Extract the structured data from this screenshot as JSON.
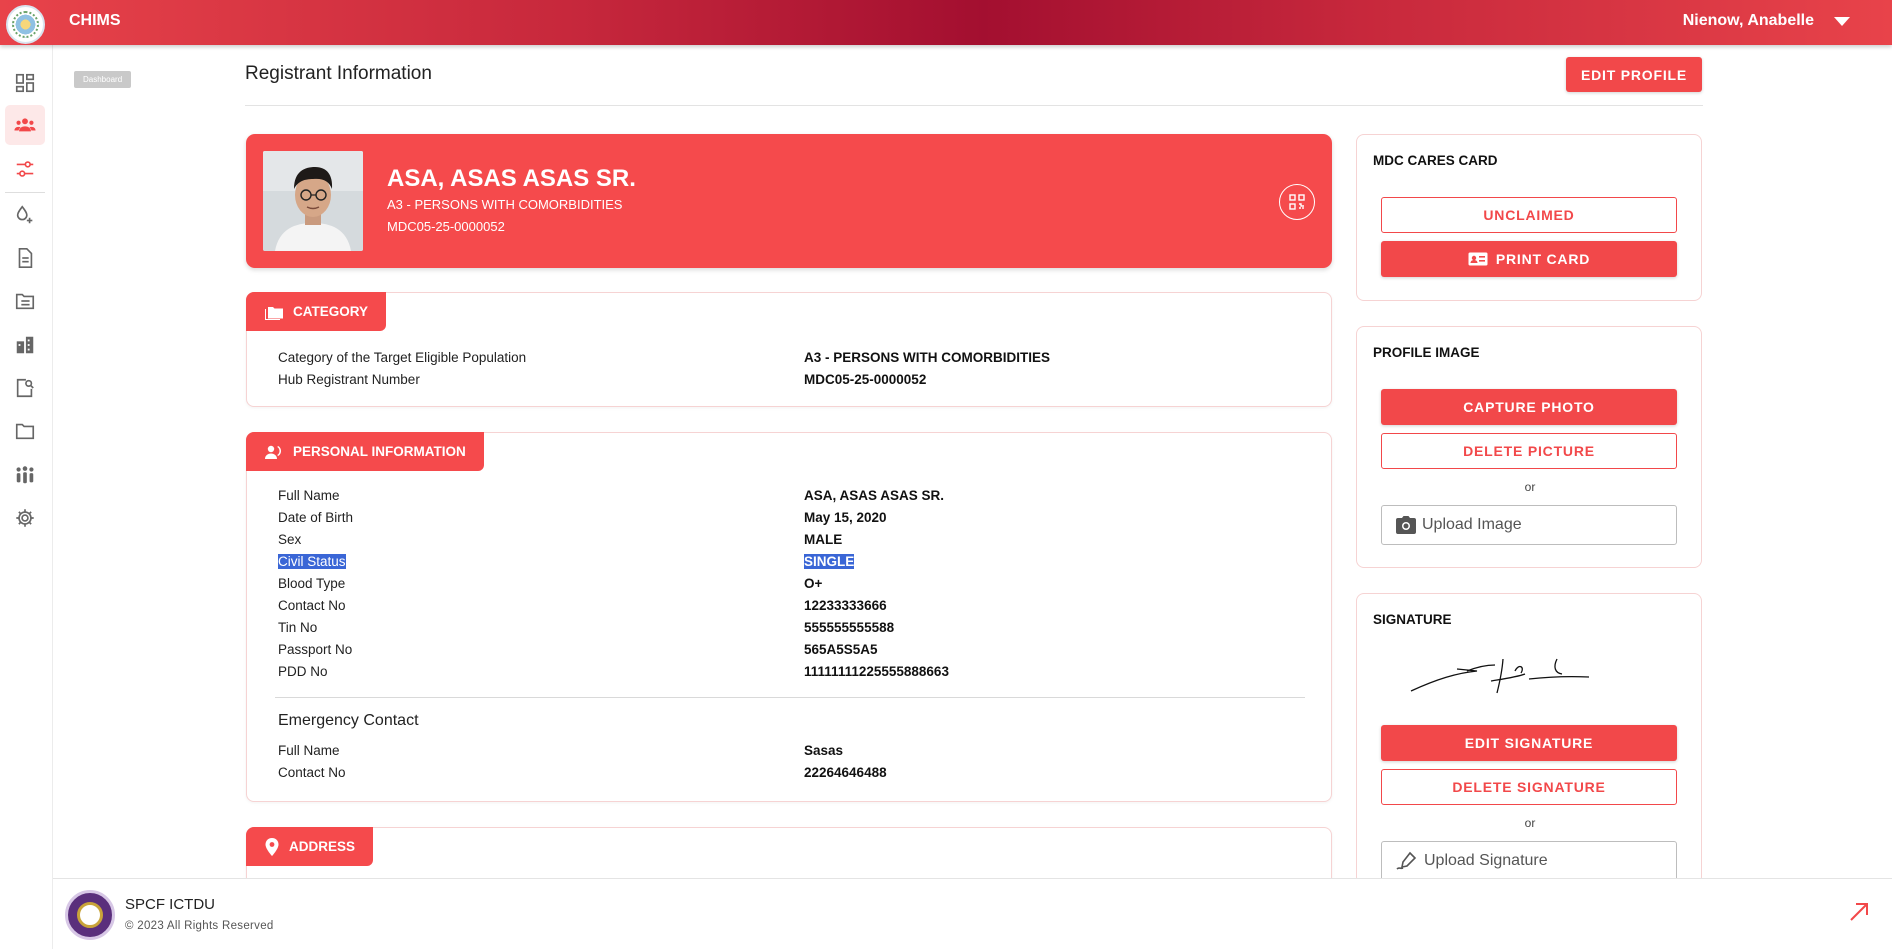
{
  "app": {
    "title": "CHIMS",
    "user_name": "Nienow, Anabelle"
  },
  "breadcrumb": "Dashboard",
  "sidebar": {
    "items": [
      {
        "icon": "dashboard-icon"
      },
      {
        "icon": "people-icon",
        "active": true
      },
      {
        "icon": "sliders-icon"
      },
      {
        "icon": "drops-icon"
      },
      {
        "icon": "document-icon"
      },
      {
        "icon": "folder-list-icon"
      },
      {
        "icon": "building-icon"
      },
      {
        "icon": "search-document-icon"
      },
      {
        "icon": "folder-icon"
      },
      {
        "icon": "group-icon"
      },
      {
        "icon": "gear-icon"
      }
    ]
  },
  "page": {
    "title": "Registrant Information",
    "edit_profile_label": "EDIT PROFILE"
  },
  "registrant": {
    "name": "ASA, ASAS ASAS SR.",
    "category": "A3 - PERSONS WITH COMORBIDITIES",
    "id": "MDC05-25-0000052"
  },
  "category_section": {
    "title": "CATEGORY",
    "rows": [
      {
        "label": "Category of the Target Eligible Population",
        "value": "A3 - PERSONS WITH COMORBIDITIES"
      },
      {
        "label": "Hub Registrant Number",
        "value": "MDC05-25-0000052"
      }
    ]
  },
  "personal_section": {
    "title": "PERSONAL INFORMATION",
    "rows": [
      {
        "label": "Full Name",
        "value": "ASA, ASAS ASAS SR."
      },
      {
        "label": "Date of Birth",
        "value": "May 15, 2020"
      },
      {
        "label": "Sex",
        "value": "MALE"
      },
      {
        "label": "Civil Status",
        "value": "SINGLE"
      },
      {
        "label": "Blood Type",
        "value": "O+"
      },
      {
        "label": "Contact No",
        "value": "12233333666"
      },
      {
        "label": "Tin No",
        "value": "555555555588"
      },
      {
        "label": "Passport No",
        "value": "565A5S5A5"
      },
      {
        "label": "PDD No",
        "value": "11111111225555888663"
      }
    ],
    "emergency_title": "Emergency Contact",
    "emergency_rows": [
      {
        "label": "Full Name",
        "value": "Sasas"
      },
      {
        "label": "Contact No",
        "value": "22264646488"
      }
    ]
  },
  "address_section": {
    "title": "ADDRESS"
  },
  "card_panel": {
    "title": "MDC CARES CARD",
    "status_label": "UNCLAIMED",
    "print_label": "PRINT CARD"
  },
  "image_panel": {
    "title": "PROFILE IMAGE",
    "capture_label": "CAPTURE PHOTO",
    "delete_label": "DELETE PICTURE",
    "or_text": "or",
    "upload_label": "Upload Image"
  },
  "signature_panel": {
    "title": "SIGNATURE",
    "edit_label": "EDIT SIGNATURE",
    "delete_label": "DELETE SIGNATURE",
    "or_text": "or",
    "upload_label": "Upload Signature"
  },
  "footer": {
    "org": "SPCF ICTDU",
    "copyright": "© 2023 All Rights Reserved"
  },
  "colors": {
    "primary": "#f54a4c",
    "topbar_dark": "#a30f30",
    "highlight": "#3a66d6"
  }
}
